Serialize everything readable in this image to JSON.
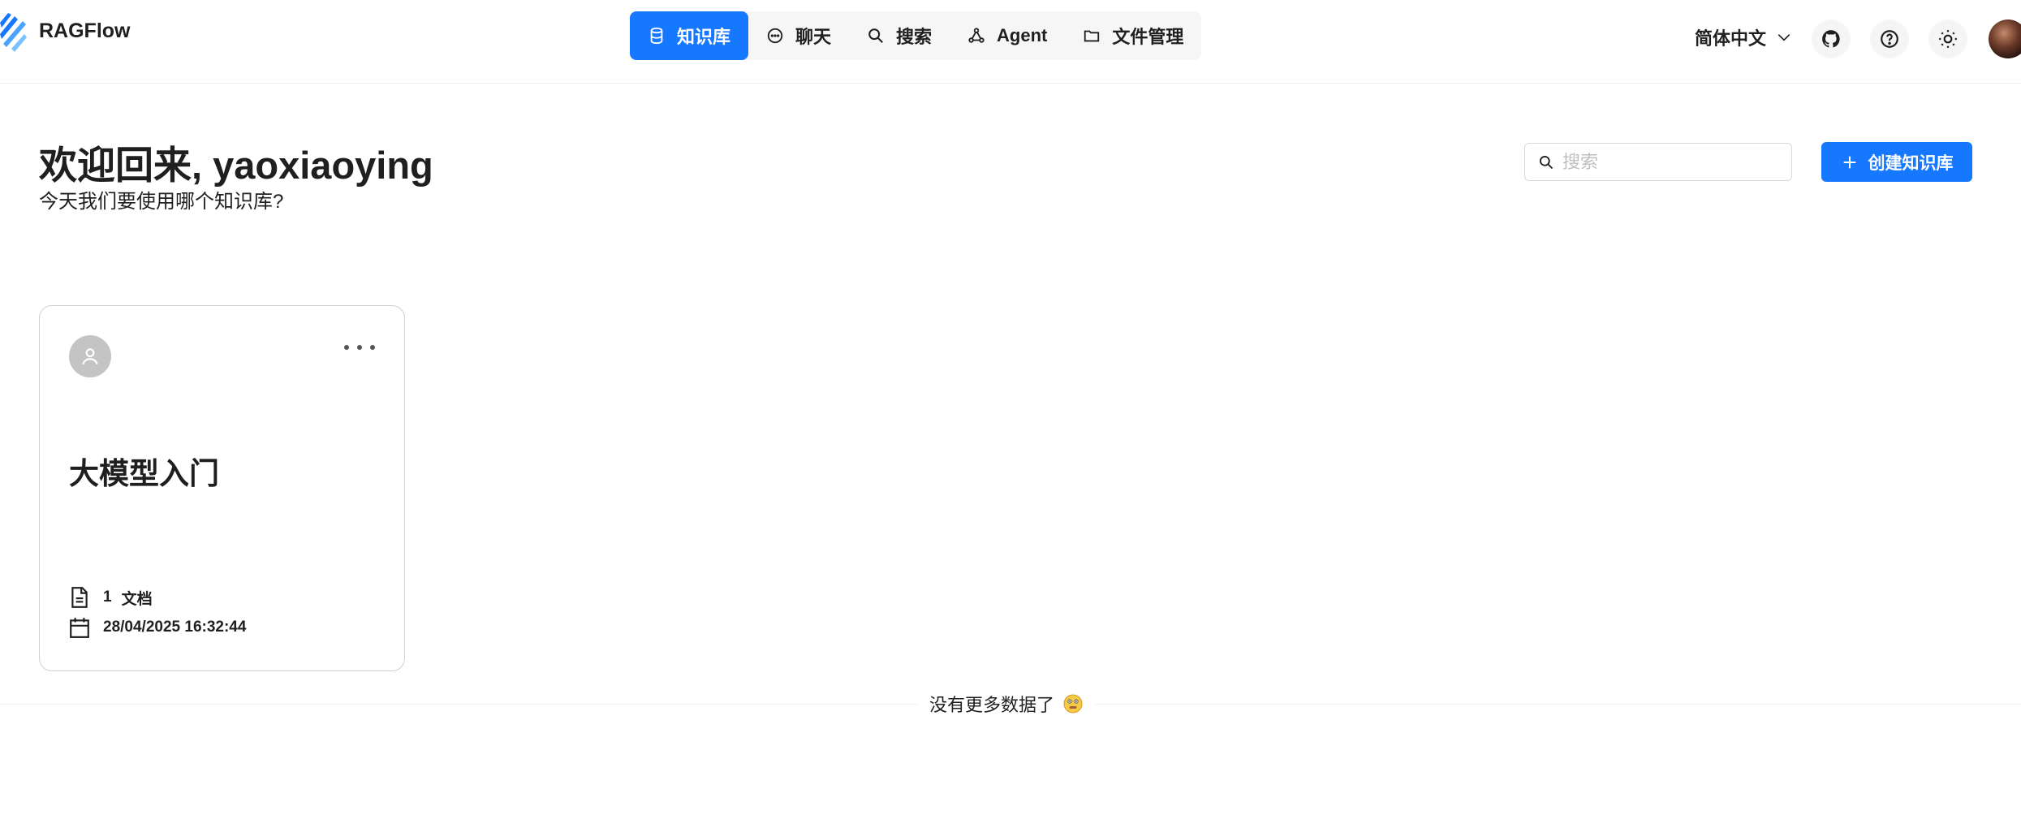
{
  "app": {
    "title": "RAGFlow",
    "accent_color": "#1677ff"
  },
  "nav": {
    "items": [
      {
        "label": "知识库",
        "icon": "database-icon",
        "active": true
      },
      {
        "label": "聊天",
        "icon": "chat-bubble-icon",
        "active": false
      },
      {
        "label": "搜索",
        "icon": "search-icon",
        "active": false
      },
      {
        "label": "Agent",
        "icon": "agent-graph-icon",
        "active": false
      },
      {
        "label": "文件管理",
        "icon": "folder-icon",
        "active": false
      }
    ]
  },
  "header_right": {
    "language": "简体中文",
    "icons": [
      "github-icon",
      "help-circle-icon",
      "sun-icon",
      "user-avatar"
    ]
  },
  "welcome": {
    "title": "欢迎回来, yaoxiaoying",
    "subtitle": "今天我们要使用哪个知识库?"
  },
  "search": {
    "placeholder": "搜索",
    "value": ""
  },
  "create_button": {
    "label": "创建知识库"
  },
  "knowledge_bases": [
    {
      "name": "大模型入门",
      "doc_count": "1",
      "doc_label": "文档",
      "updated": "28/04/2025 16:32:44"
    }
  ],
  "footer": {
    "no_more_text": "没有更多数据了"
  }
}
